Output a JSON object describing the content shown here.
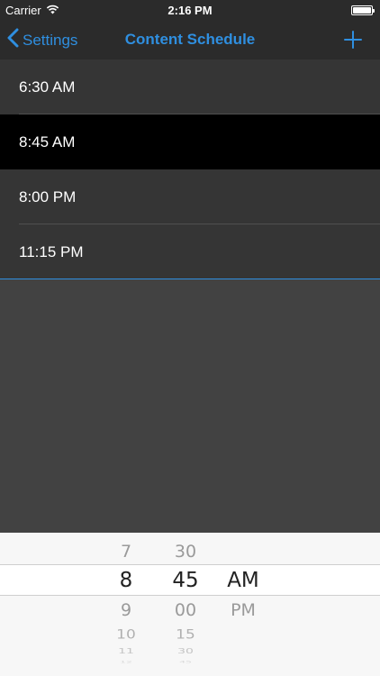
{
  "status_bar": {
    "carrier": "Carrier",
    "time": "2:16 PM",
    "wifi_icon": "wifi-icon",
    "battery_icon": "battery-icon"
  },
  "nav": {
    "back_label": "Settings",
    "title": "Content Schedule",
    "back_icon": "chevron-left-icon",
    "add_icon": "plus-icon"
  },
  "schedule": {
    "items": [
      {
        "time": "6:30 AM"
      },
      {
        "time": "8:45 AM",
        "selected": true
      },
      {
        "time": "8:00 PM"
      },
      {
        "time": "11:15 PM"
      }
    ]
  },
  "picker": {
    "hours": {
      "above": "7",
      "selected": "8",
      "below": [
        "9",
        "10",
        "11",
        "12"
      ]
    },
    "minutes": {
      "above": "30",
      "selected": "45",
      "below": [
        "00",
        "15",
        "30",
        "45"
      ]
    },
    "ampm": {
      "selected": "AM",
      "below": "PM"
    }
  },
  "colors": {
    "accent": "#2f8fe0",
    "bar_background": "#2b2b2b",
    "row_background": "#353535",
    "selected_row": "#000000",
    "screen_background": "#424242",
    "picker_background": "#f7f7f7"
  }
}
